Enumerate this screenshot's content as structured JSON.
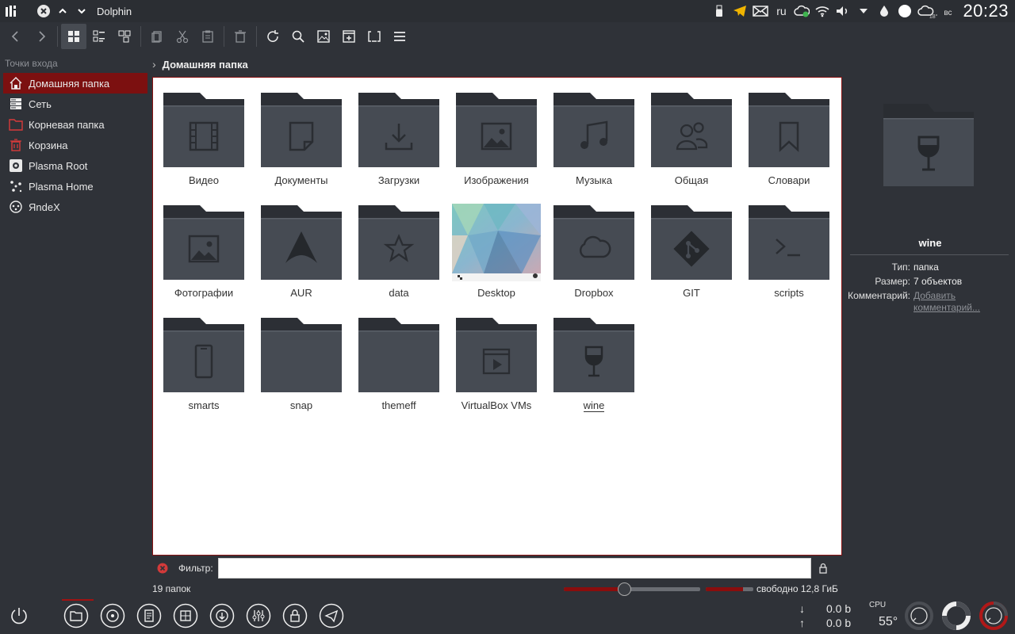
{
  "window": {
    "title": "Dolphin"
  },
  "tray": {
    "language": "ru",
    "temperature": "18°",
    "day": "вс",
    "clock": "20:23"
  },
  "toolbar": {
    "buttons": [
      "back",
      "forward",
      "icons-view",
      "details-view",
      "split-view",
      "copy",
      "cut",
      "paste",
      "delete",
      "reload",
      "search",
      "preview",
      "new-tab",
      "select",
      "menu"
    ]
  },
  "places": {
    "heading": "Точки входа",
    "items": [
      {
        "label": "Домашняя папка",
        "icon": "home-icon"
      },
      {
        "label": "Сеть",
        "icon": "network-icon"
      },
      {
        "label": "Корневая папка",
        "icon": "folder-red-icon"
      },
      {
        "label": "Корзина",
        "icon": "trash-icon"
      },
      {
        "label": "Plasma Root",
        "icon": "gear-icon"
      },
      {
        "label": "Plasma Home",
        "icon": "dots-icon"
      },
      {
        "label": "ЯndeX",
        "icon": "yandex-icon"
      }
    ]
  },
  "breadcrumb": {
    "current": "Домашняя папка"
  },
  "files": [
    {
      "name": "Видео",
      "icon": "film-icon"
    },
    {
      "name": "Документы",
      "icon": "document-icon"
    },
    {
      "name": "Загрузки",
      "icon": "download-icon"
    },
    {
      "name": "Изображения",
      "icon": "image-icon"
    },
    {
      "name": "Музыка",
      "icon": "music-icon"
    },
    {
      "name": "Общая",
      "icon": "users-icon"
    },
    {
      "name": "Словари",
      "icon": "bookmark-icon"
    },
    {
      "name": "Фотографии",
      "icon": "image-icon"
    },
    {
      "name": "AUR",
      "icon": "arch-icon"
    },
    {
      "name": "data",
      "icon": "star-icon"
    },
    {
      "name": "Desktop",
      "icon": "desktop-thumbnail"
    },
    {
      "name": "Dropbox",
      "icon": "cloud-icon"
    },
    {
      "name": "GIT",
      "icon": "git-icon"
    },
    {
      "name": "scripts",
      "icon": "terminal-icon"
    },
    {
      "name": "smarts",
      "icon": "phone-icon"
    },
    {
      "name": "snap",
      "icon": "none"
    },
    {
      "name": "themeff",
      "icon": "none"
    },
    {
      "name": "VirtualBox VMs",
      "icon": "video-icon"
    },
    {
      "name": "wine",
      "icon": "wine-icon"
    }
  ],
  "info": {
    "name": "wine",
    "type_label": "Тип:",
    "type_value": "папка",
    "size_label": "Размер:",
    "size_value": "7 объектов",
    "comment_label": "Комментарий:",
    "comment_link": "Добавить комментарий..."
  },
  "filter": {
    "label": "Фильтр:",
    "value": ""
  },
  "status": {
    "count": "19 папок",
    "free": "свободно 12,8 ГиБ",
    "zoom_level": 0.44,
    "disk_used": 0.78
  },
  "dock": {
    "net_down": "0.0 b",
    "net_up": "0.0 b",
    "down_arrow": "↓",
    "up_arrow": "↑",
    "cpu_label": "CPU",
    "cpu_temp": "55°"
  },
  "colors": {
    "accent": "#8a0d0d",
    "folder": "#454a52",
    "folder_tab": "#2c2f35"
  }
}
